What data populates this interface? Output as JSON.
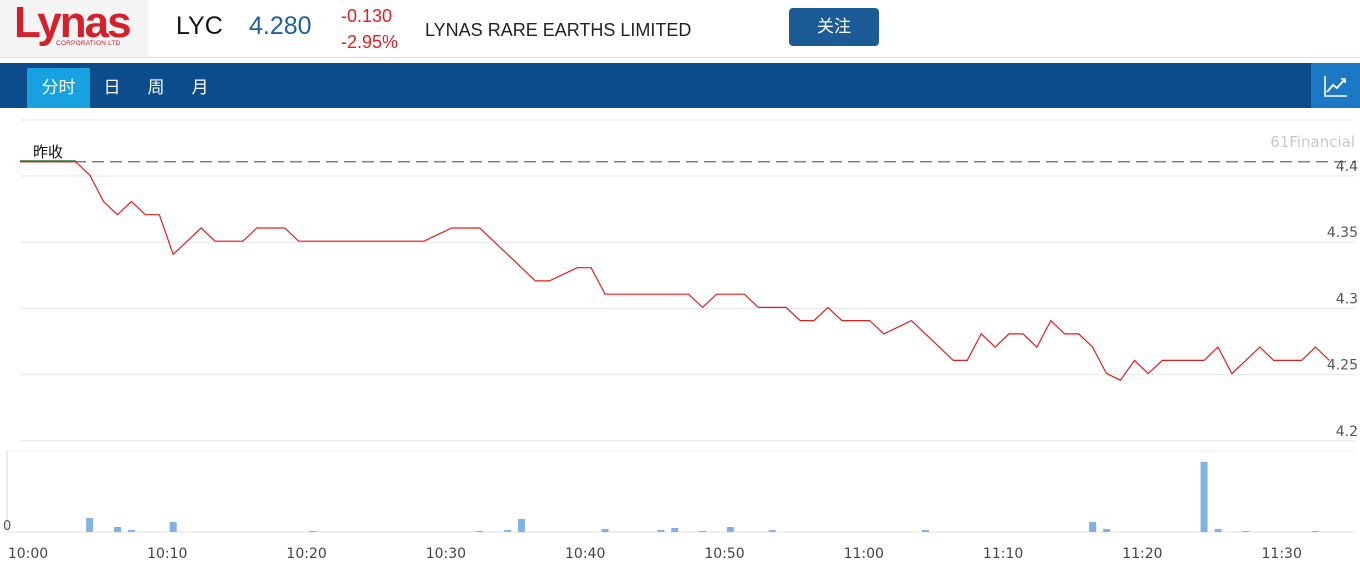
{
  "header": {
    "logo_text": "Lynas",
    "logo_sub": "CORPORATION LTD",
    "ticker": "LYC",
    "price": "4.280",
    "change": "-0.130",
    "change_pct": "-2.95%",
    "company_name": "LYNAS RARE EARTHS LIMITED",
    "follow_label": "关注"
  },
  "tabs": [
    {
      "label": "分时",
      "active": true
    },
    {
      "label": "日",
      "active": false
    },
    {
      "label": "周",
      "active": false
    },
    {
      "label": "月",
      "active": false
    }
  ],
  "chart_icon": "line-chart-icon",
  "colors": {
    "price_line": "#e41d1d",
    "prev_close_line": "#333333",
    "volume_bar": "#7fb3e8",
    "nav_bg": "#0d4c8a",
    "tab_active": "#16a1e0",
    "up": "#e41d1d",
    "price_text": "#1e5fa0"
  },
  "chart_data": {
    "type": "line",
    "watermark": "61Financial",
    "prev_close_label": "昨收",
    "prev_close": 4.41,
    "y_ticks": [
      "4.4",
      "4.35",
      "4.3",
      "4.25",
      "4.2"
    ],
    "y_tick_values": [
      4.4,
      4.35,
      4.3,
      4.25,
      4.2
    ],
    "ylim": [
      4.2,
      4.45
    ],
    "x_tick_labels": [
      "10:00",
      "10:10",
      "10:20",
      "10:30",
      "10:40",
      "10:50",
      "11:00",
      "11:10",
      "11:20",
      "11:30"
    ],
    "x_range_minutes": [
      0,
      95
    ],
    "price": {
      "minutes": [
        0,
        4,
        5,
        6,
        7,
        8,
        9,
        10,
        11,
        12,
        13,
        14,
        15,
        16,
        17,
        18,
        19,
        20,
        21,
        22,
        23,
        24,
        25,
        26,
        27,
        28,
        29,
        30,
        31,
        32,
        33,
        34,
        35,
        36,
        37,
        38,
        39,
        40,
        41,
        42,
        43,
        44,
        45,
        46,
        47,
        48,
        49,
        50,
        51,
        52,
        53,
        54,
        55,
        56,
        57,
        58,
        59,
        60,
        61,
        62,
        63,
        64,
        65,
        66,
        67,
        68,
        69,
        70,
        71,
        72,
        73,
        74,
        75,
        76,
        77,
        78,
        79,
        80,
        81,
        82,
        83,
        84,
        85,
        86,
        87,
        88,
        89,
        90,
        91,
        92,
        93,
        94
      ],
      "values": [
        4.41,
        4.41,
        4.4,
        4.38,
        4.37,
        4.38,
        4.37,
        4.37,
        4.34,
        4.35,
        4.36,
        4.35,
        4.35,
        4.35,
        4.36,
        4.36,
        4.36,
        4.35,
        4.35,
        4.35,
        4.35,
        4.35,
        4.35,
        4.35,
        4.35,
        4.35,
        4.35,
        4.355,
        4.36,
        4.36,
        4.36,
        4.35,
        4.34,
        4.33,
        4.32,
        4.32,
        4.325,
        4.33,
        4.33,
        4.31,
        4.31,
        4.31,
        4.31,
        4.31,
        4.31,
        4.31,
        4.3,
        4.31,
        4.31,
        4.31,
        4.3,
        4.3,
        4.3,
        4.29,
        4.29,
        4.3,
        4.29,
        4.29,
        4.29,
        4.28,
        4.285,
        4.29,
        4.28,
        4.27,
        4.26,
        4.26,
        4.28,
        4.27,
        4.28,
        4.28,
        4.27,
        4.29,
        4.28,
        4.28,
        4.27,
        4.25,
        4.245,
        4.26,
        4.25,
        4.26,
        4.26,
        4.26,
        4.26,
        4.27,
        4.25,
        4.26,
        4.27,
        4.26,
        4.26,
        4.26,
        4.27,
        4.26,
        4.28
      ]
    },
    "volume": {
      "zero_label": "0",
      "minutes": [
        5,
        7,
        8,
        11,
        21,
        33,
        35,
        36,
        42,
        46,
        47,
        49,
        51,
        54,
        65,
        77,
        78,
        85,
        86,
        88,
        93
      ],
      "values": [
        14,
        5,
        2,
        10,
        1,
        1,
        2,
        13,
        3,
        2,
        4,
        1,
        5,
        2,
        2,
        10,
        3,
        70,
        3,
        1,
        1
      ]
    },
    "grid": true
  }
}
